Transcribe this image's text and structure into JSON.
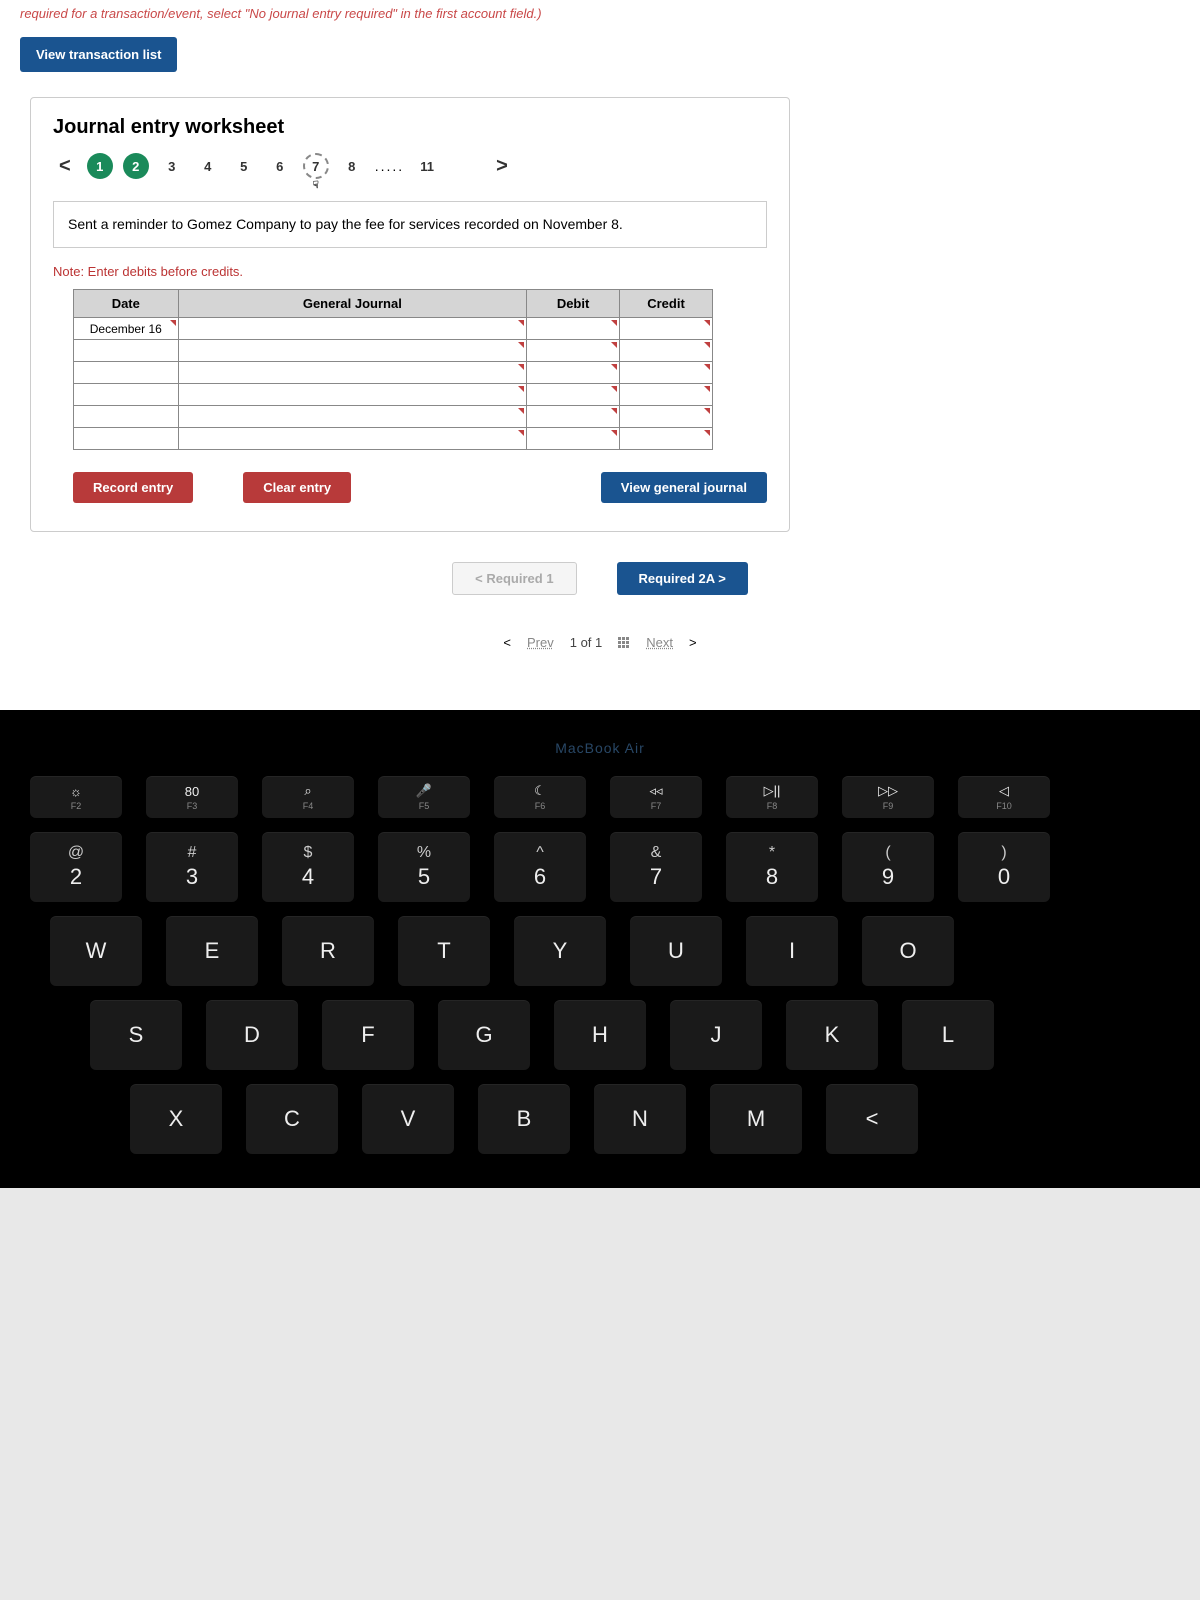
{
  "instruction": "required for a transaction/event, select \"No journal entry required\" in the first account field.)",
  "viewTransBtn": "View transaction list",
  "wsTitle": "Journal entry worksheet",
  "steps": [
    "1",
    "2",
    "3",
    "4",
    "5",
    "6",
    "7",
    "8",
    ".....",
    "11"
  ],
  "desc": "Sent a reminder to Gomez Company to pay the fee for services recorded on November 8.",
  "note": "Note: Enter debits before credits.",
  "headers": {
    "date": "Date",
    "gj": "General Journal",
    "debit": "Debit",
    "credit": "Credit"
  },
  "dateVal": "December 16",
  "actions": {
    "record": "Record entry",
    "clear": "Clear entry",
    "view": "View general journal"
  },
  "reqBtns": {
    "prev": "<   Required 1",
    "next": "Required 2A   >"
  },
  "pager": {
    "prev": "Prev",
    "count": "1 of 1",
    "next": "Next"
  },
  "brand": "MacBook Air",
  "fnRow": [
    {
      "ico": "☼",
      "lbl": "F2"
    },
    {
      "ico": "80",
      "lbl": "F3"
    },
    {
      "ico": "⌕",
      "lbl": "F4"
    },
    {
      "ico": "🎤",
      "lbl": "F5"
    },
    {
      "ico": "☾",
      "lbl": "F6"
    },
    {
      "ico": "◃◃",
      "lbl": "F7"
    },
    {
      "ico": "▷||",
      "lbl": "F8"
    },
    {
      "ico": "▷▷",
      "lbl": "F9"
    },
    {
      "ico": "◁",
      "lbl": "F10"
    }
  ],
  "numRow": [
    {
      "t": "@",
      "b": "2"
    },
    {
      "t": "#",
      "b": "3"
    },
    {
      "t": "$",
      "b": "4"
    },
    {
      "t": "%",
      "b": "5"
    },
    {
      "t": "^",
      "b": "6"
    },
    {
      "t": "&",
      "b": "7"
    },
    {
      "t": "*",
      "b": "8"
    },
    {
      "t": "(",
      "b": "9"
    },
    {
      "t": ")",
      "b": "0"
    }
  ],
  "row2": [
    "W",
    "E",
    "R",
    "T",
    "Y",
    "U",
    "I",
    "O"
  ],
  "row3": [
    "S",
    "D",
    "F",
    "G",
    "H",
    "J",
    "K",
    "L"
  ],
  "row4": [
    "X",
    "C",
    "V",
    "B",
    "N",
    "M",
    "<"
  ]
}
